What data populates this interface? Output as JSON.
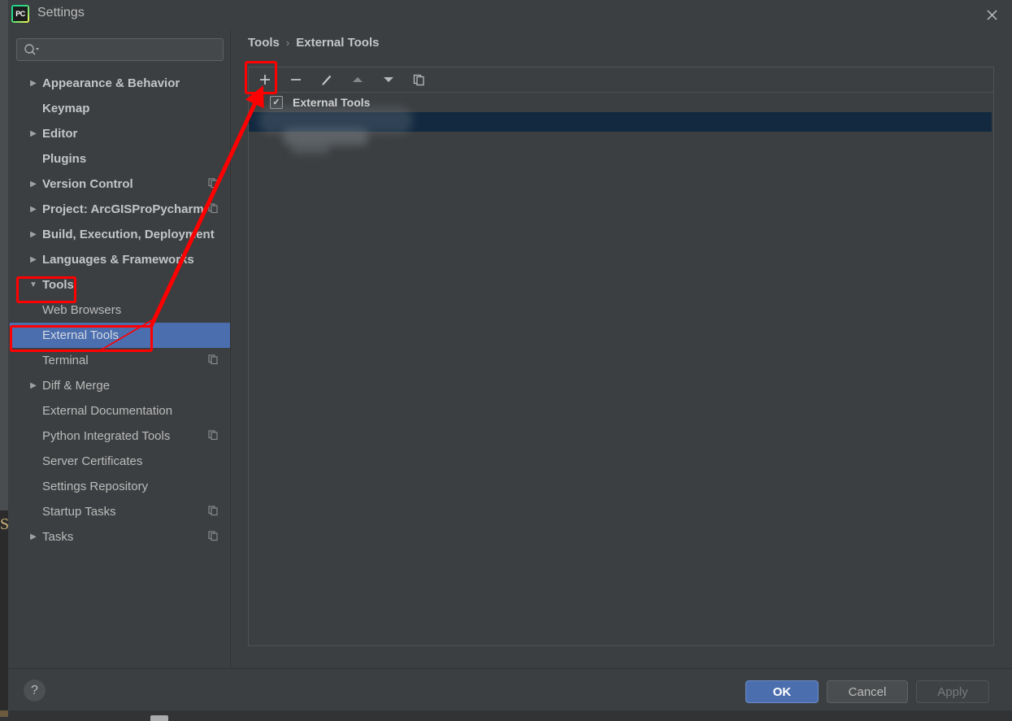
{
  "window": {
    "title": "Settings",
    "app_icon": "pycharm-logo-icon",
    "close_icon": "close-icon"
  },
  "search": {
    "placeholder": "",
    "value": "",
    "icon": "search-icon"
  },
  "sidebar": {
    "items": [
      {
        "label": "Appearance & Behavior",
        "level": 0,
        "twisty": "▶",
        "selected": false,
        "copy_icon": false
      },
      {
        "label": "Keymap",
        "level": 0,
        "twisty": "",
        "selected": false,
        "copy_icon": false
      },
      {
        "label": "Editor",
        "level": 0,
        "twisty": "▶",
        "selected": false,
        "copy_icon": false
      },
      {
        "label": "Plugins",
        "level": 0,
        "twisty": "",
        "selected": false,
        "copy_icon": false
      },
      {
        "label": "Version Control",
        "level": 0,
        "twisty": "▶",
        "selected": false,
        "copy_icon": true
      },
      {
        "label": "Project: ArcGISProPycharm",
        "level": 0,
        "twisty": "▶",
        "selected": false,
        "copy_icon": true
      },
      {
        "label": "Build, Execution, Deployment",
        "level": 0,
        "twisty": "▶",
        "selected": false,
        "copy_icon": false
      },
      {
        "label": "Languages & Frameworks",
        "level": 0,
        "twisty": "▶",
        "selected": false,
        "copy_icon": false
      },
      {
        "label": "Tools",
        "level": 0,
        "twisty": "▼",
        "selected": false,
        "copy_icon": false
      },
      {
        "label": "Web Browsers",
        "level": 1,
        "twisty": "",
        "selected": false,
        "copy_icon": false
      },
      {
        "label": "External Tools",
        "level": 1,
        "twisty": "",
        "selected": true,
        "copy_icon": false
      },
      {
        "label": "Terminal",
        "level": 1,
        "twisty": "",
        "selected": false,
        "copy_icon": true
      },
      {
        "label": "Diff & Merge",
        "level": 1,
        "twisty": "▶",
        "selected": false,
        "copy_icon": false
      },
      {
        "label": "External Documentation",
        "level": 1,
        "twisty": "",
        "selected": false,
        "copy_icon": false
      },
      {
        "label": "Python Integrated Tools",
        "level": 1,
        "twisty": "",
        "selected": false,
        "copy_icon": true
      },
      {
        "label": "Server Certificates",
        "level": 1,
        "twisty": "",
        "selected": false,
        "copy_icon": false
      },
      {
        "label": "Settings Repository",
        "level": 1,
        "twisty": "",
        "selected": false,
        "copy_icon": false
      },
      {
        "label": "Startup Tasks",
        "level": 1,
        "twisty": "",
        "selected": false,
        "copy_icon": true
      },
      {
        "label": "Tasks",
        "level": 1,
        "twisty": "▶",
        "selected": false,
        "copy_icon": true
      }
    ]
  },
  "content": {
    "breadcrumb": {
      "parent": "Tools",
      "separator": "›",
      "current": "External Tools"
    },
    "toolbar": {
      "add_label": "+",
      "remove_label": "−",
      "edit_icon": "pencil-icon",
      "move_up_icon": "arrow-up-icon",
      "move_down_icon": "arrow-down-icon",
      "copy_icon": "copy-icon"
    },
    "tree": {
      "root_label": "External Tools",
      "root_checked": true,
      "root_check_glyph": "✓",
      "root_twisty": "▼",
      "child_rows_redacted": 2
    }
  },
  "footer": {
    "help_label": "?",
    "ok_label": "OK",
    "cancel_label": "Cancel",
    "apply_label": "Apply",
    "apply_enabled": false
  },
  "background": {
    "partial_letter": "S"
  },
  "annotations": {
    "accent_color": "#ff0000",
    "boxes": [
      "add-button",
      "tools-sidebar-item",
      "external-tools-sidebar-item"
    ],
    "arrow_from": "external-tools-sidebar-item",
    "arrow_to": "add-button"
  },
  "colors": {
    "dialog_bg": "#3c3f41",
    "selection_blue": "#4b6eaf",
    "tree_selection_navy": "#12293f",
    "text": "#bbbbbb",
    "annotation_red": "#ff0000"
  }
}
